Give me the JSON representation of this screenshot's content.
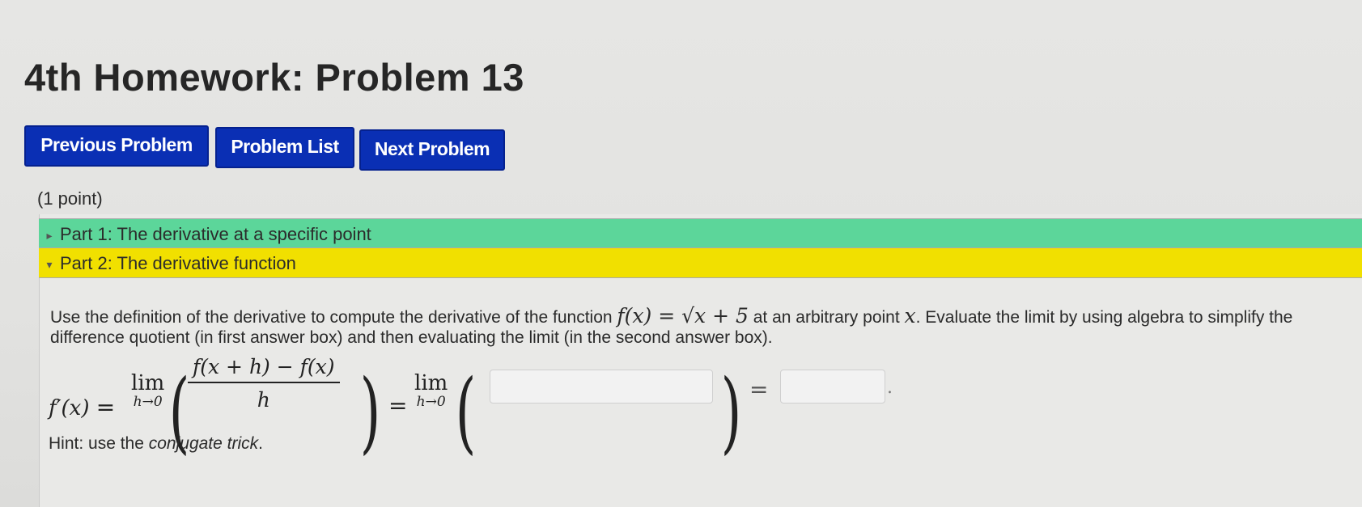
{
  "page": {
    "title": "4th Homework: Problem 13"
  },
  "nav": {
    "previous": "Previous Problem",
    "list": "Problem List",
    "next": "Next Problem"
  },
  "problem": {
    "points": "(1 point)",
    "parts": [
      {
        "label": "Part 1: The derivative at a specific point",
        "expanded": false,
        "color": "#5cd69a"
      },
      {
        "label": "Part 2: The derivative function",
        "expanded": true,
        "color": "#f1e000"
      }
    ],
    "text_a": "Use the definition of the derivative to compute the derivative of the function ",
    "func": "f(x) = √x + 5",
    "text_b": " at an arbitrary point ",
    "var_x": "x",
    "text_c": ". Evaluate the limit by using algebra to simplify the difference quotient (in first answer box) and then evaluating the limit (in the second answer box).",
    "equation": {
      "lhs": "f′(x)",
      "equals": "=",
      "lim_word": "lim",
      "lim_sub": "h→0",
      "numerator": "f(x + h) − f(x)",
      "denominator": "h",
      "period": "."
    },
    "answers": {
      "box1_value": "",
      "box2_value": ""
    },
    "hint_prefix": "Hint: use the ",
    "hint_em": "conjugate trick",
    "hint_suffix": "."
  },
  "colors": {
    "button": "#0a2fb4",
    "part1": "#5cd69a",
    "part2": "#f1e000"
  }
}
